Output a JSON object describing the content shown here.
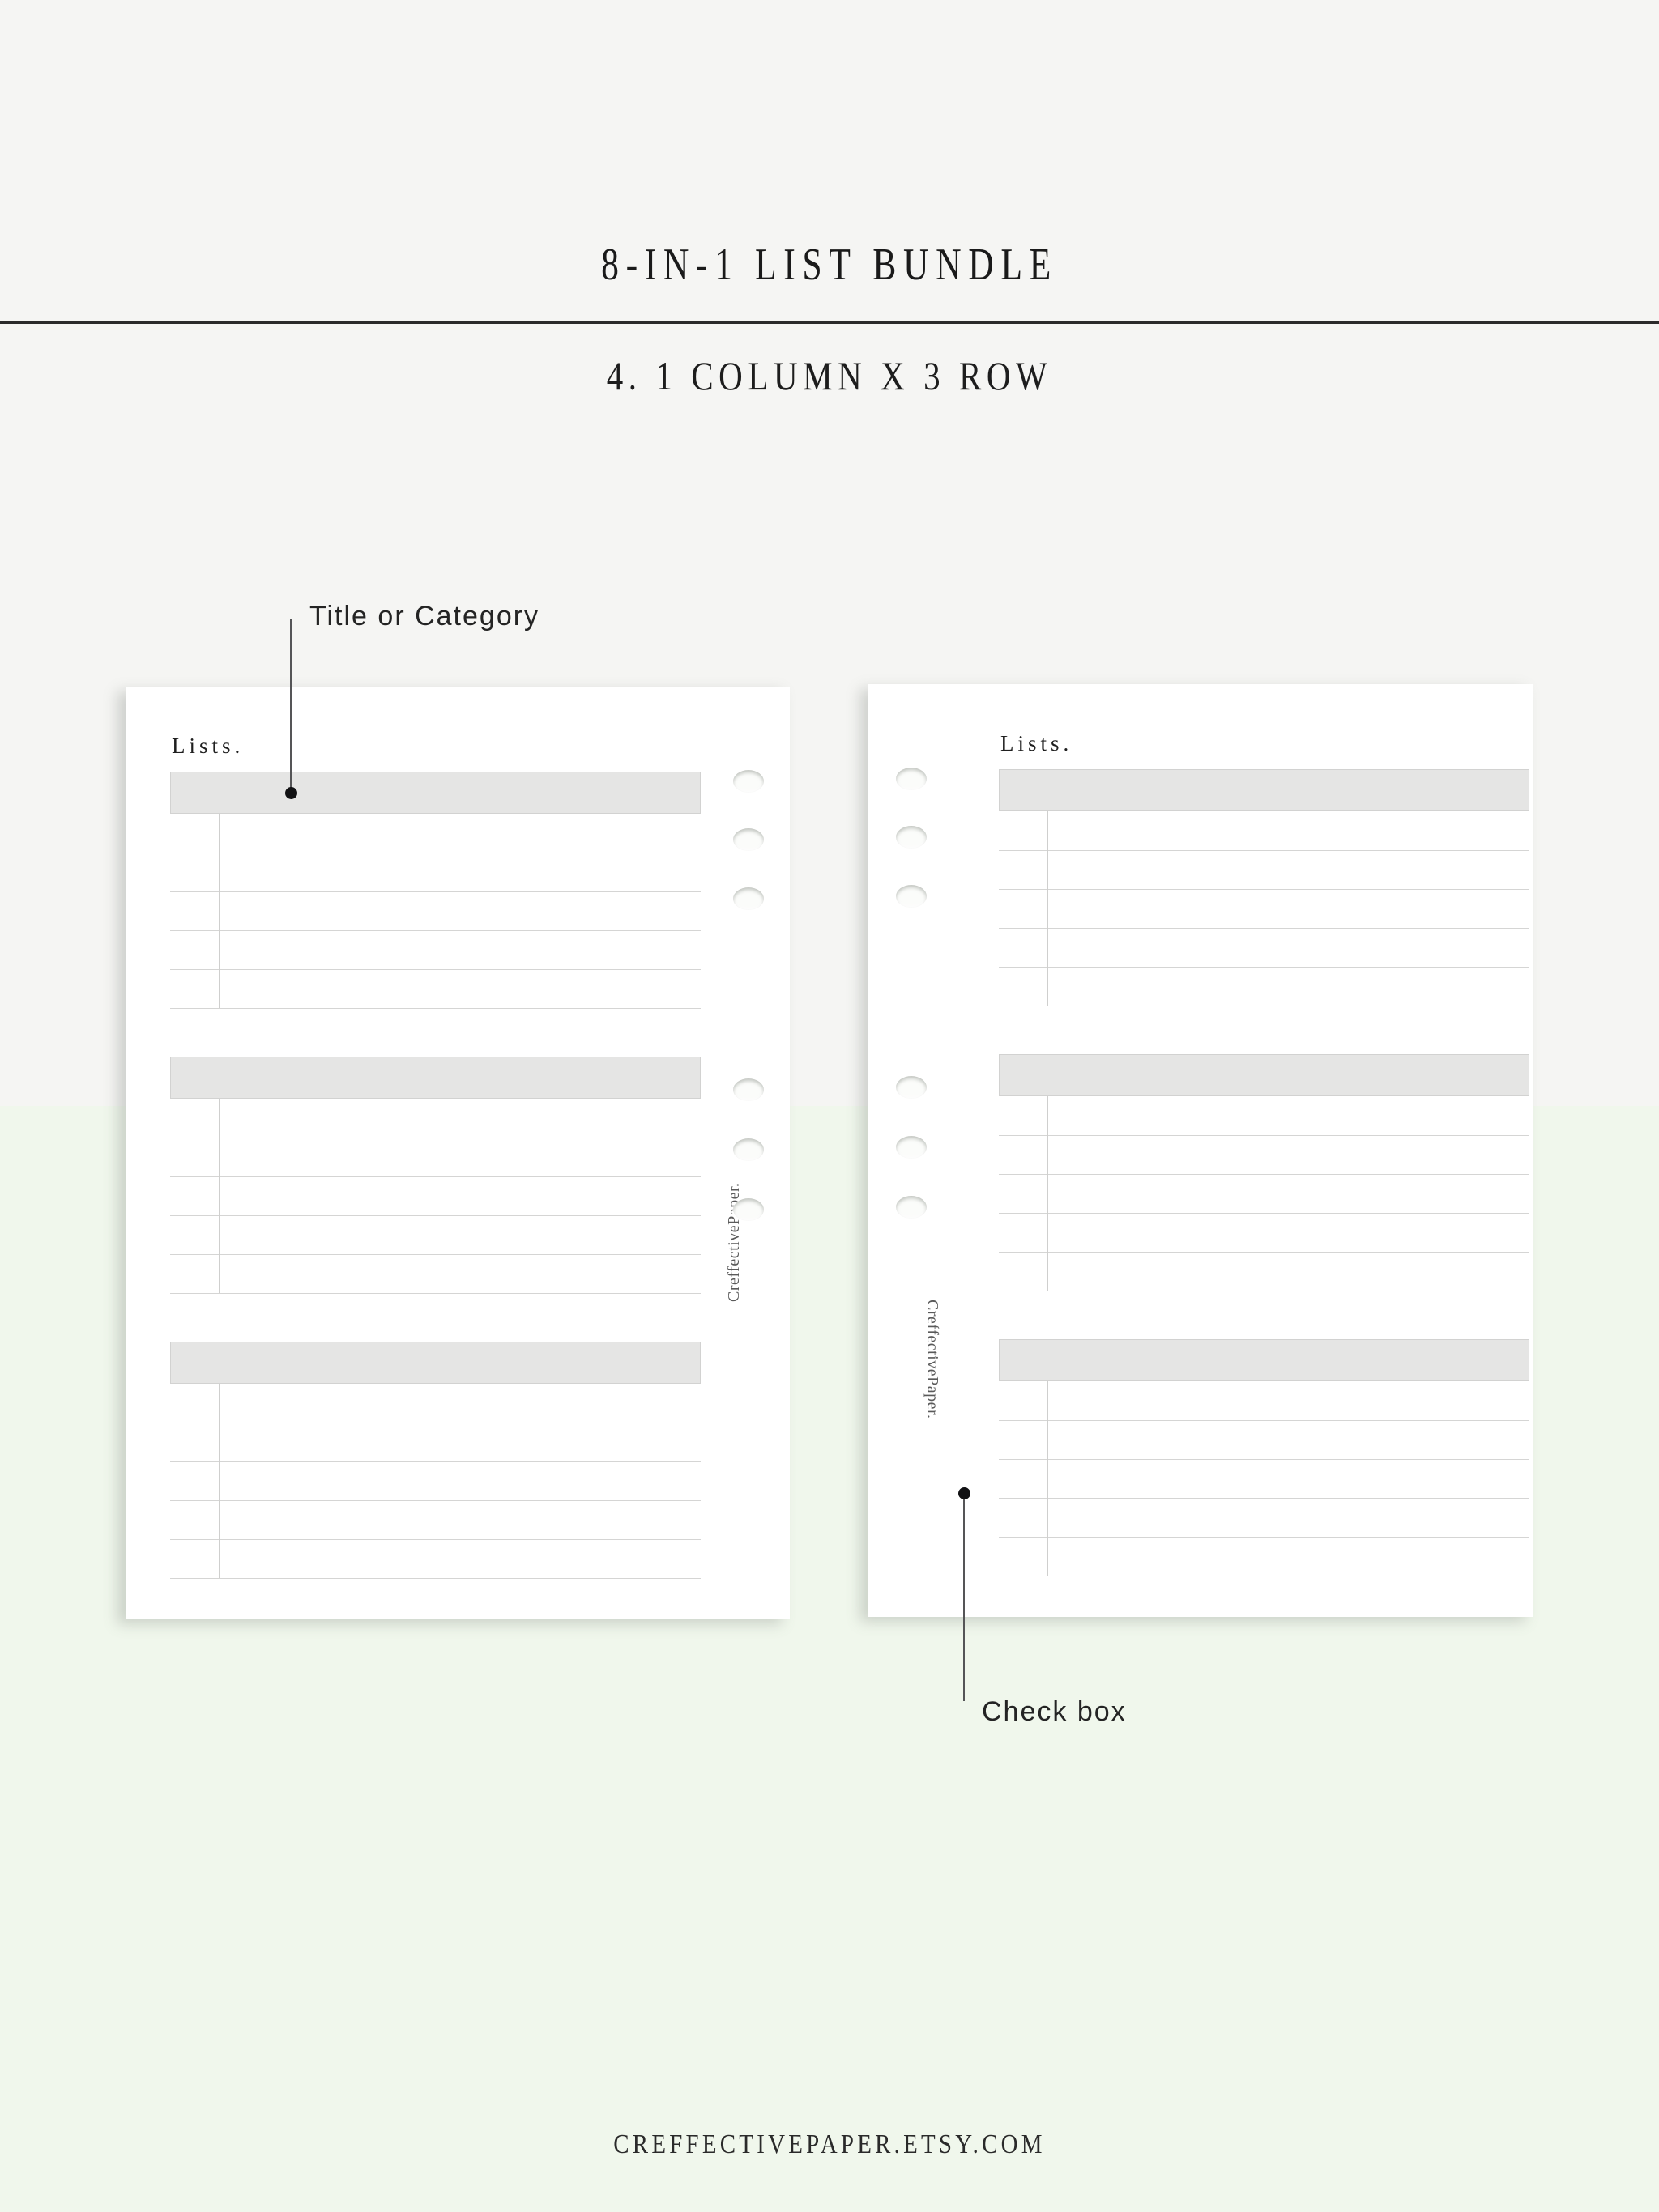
{
  "header": {
    "title": "8-IN-1 LIST BUNDLE",
    "subtitle": "4. 1 COLUMN X 3 ROW"
  },
  "footer": {
    "shop_url": "CREFFECTIVEPAPER.ETSY.COM"
  },
  "callouts": [
    {
      "id": "title-or-category",
      "label": "Title or Category"
    },
    {
      "id": "check-box",
      "label": "Check box"
    }
  ],
  "pages": [
    {
      "id": "left-page",
      "label": "Lists.",
      "watermark": "CreffectivePaper.",
      "ring_holes": 6,
      "sections": [
        {
          "header_label": "",
          "rows": 5
        },
        {
          "header_label": "",
          "rows": 5
        },
        {
          "header_label": "",
          "rows": 5
        }
      ]
    },
    {
      "id": "right-page",
      "label": "Lists.",
      "watermark": "CreffectivePaper.",
      "ring_holes": 6,
      "sections": [
        {
          "header_label": "",
          "rows": 5
        },
        {
          "header_label": "",
          "rows": 5
        },
        {
          "header_label": "",
          "rows": 5
        }
      ]
    }
  ],
  "colors": {
    "background_top": "#f5f5f3",
    "background_bottom": "#f0f7ec",
    "page": "#ffffff",
    "section_header": "#e5e5e4",
    "rule": "#d5d5d4",
    "text": "#1a1a1a"
  }
}
